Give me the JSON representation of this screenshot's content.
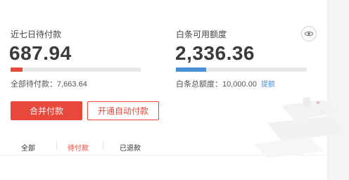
{
  "pending": {
    "label": "近七日待付款",
    "amount": "687.94",
    "progress_fraction": 0.09,
    "total_text": "全部待付款：7,663.64"
  },
  "credit": {
    "label": "白条可用额度",
    "amount": "2,336.36",
    "progress_fraction": 0.23,
    "total_text": "白条总额度：10,000.00",
    "link": "提额"
  },
  "buttons": {
    "merge_pay": "合并付款",
    "auto_pay": "开通自动付款"
  },
  "tabs": [
    {
      "label": "全部",
      "active": false
    },
    {
      "label": "待付款",
      "active": true
    },
    {
      "label": "已退款",
      "active": false
    }
  ],
  "colors": {
    "accent_red": "#e8473b",
    "accent_blue": "#4a90d9"
  },
  "icons": {
    "visibility": "eye-icon"
  }
}
